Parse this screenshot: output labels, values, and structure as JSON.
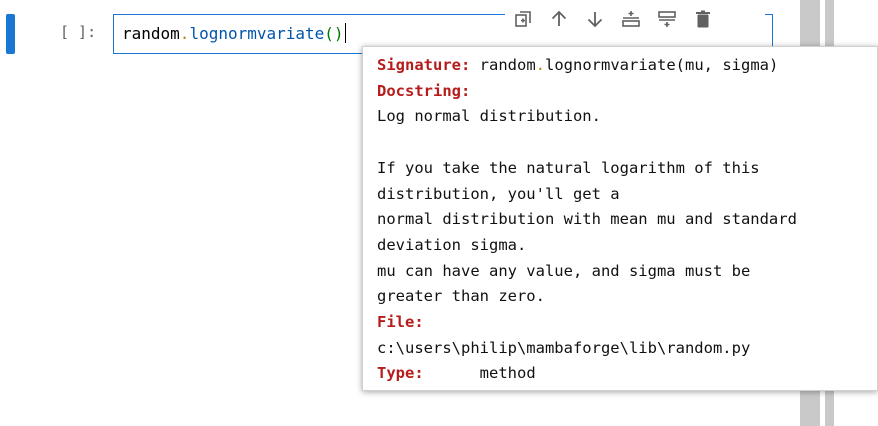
{
  "cell": {
    "prompt": "[ ]:",
    "code_object": "random",
    "code_method": "lognormvariate",
    "code_parens": "()"
  },
  "toolbar": {
    "buttons": [
      {
        "name": "duplicate-cell-button",
        "icon": "duplicate-icon"
      },
      {
        "name": "move-up-button",
        "icon": "arrow-up-icon"
      },
      {
        "name": "move-down-button",
        "icon": "arrow-down-icon"
      },
      {
        "name": "insert-above-button",
        "icon": "insert-above-icon"
      },
      {
        "name": "insert-below-button",
        "icon": "insert-below-icon"
      },
      {
        "name": "delete-cell-button",
        "icon": "trash-icon"
      }
    ]
  },
  "tooltip": {
    "signature_label": "Signature:",
    "signature_object": "random",
    "signature_method": "lognormvariate",
    "signature_args": "(mu, sigma)",
    "docstring_label": "Docstring:",
    "docstring_lines": [
      "Log normal distribution.",
      "",
      "If you take the natural logarithm of this",
      "distribution, you'll get a",
      "normal distribution with mean mu and standard",
      "deviation sigma.",
      "mu can have any value, and sigma must be",
      "greater than zero."
    ],
    "file_label": "File:",
    "file_path": "c:\\users\\philip\\mambaforge\\lib\\random.py",
    "type_label": "Type:",
    "type_value": "method"
  },
  "colors": {
    "accent": "#1976d2",
    "keyword": "#b71c1c"
  }
}
